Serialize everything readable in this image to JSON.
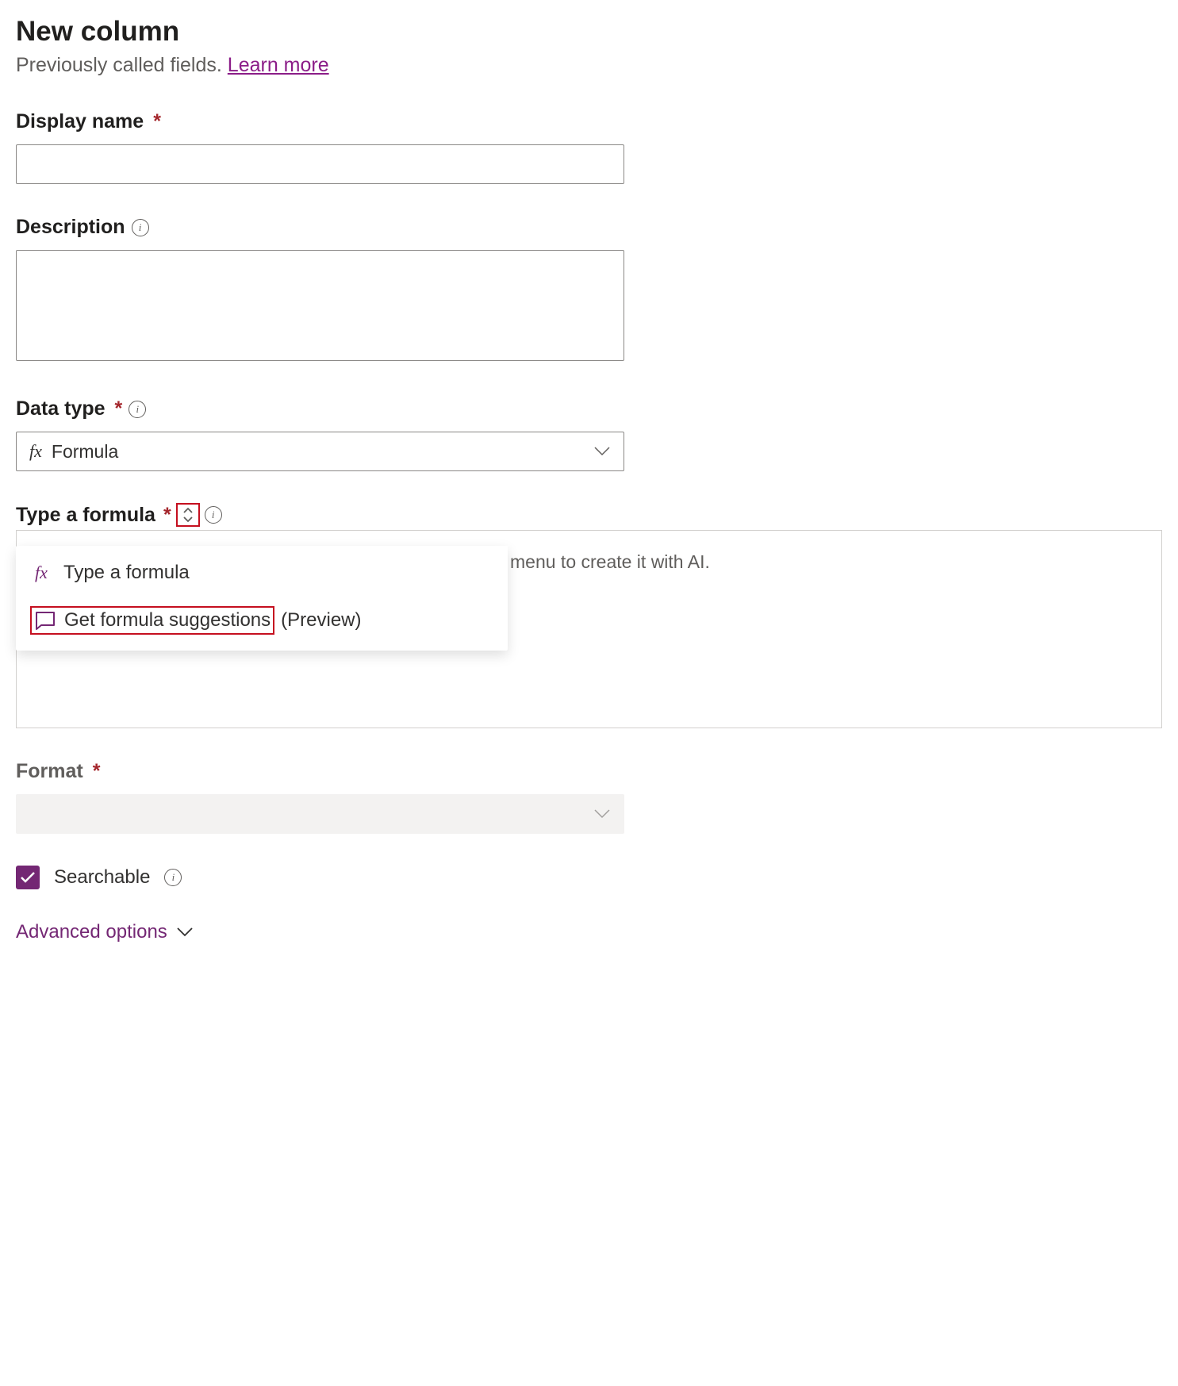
{
  "header": {
    "title": "New column",
    "subtitle_prefix": "Previously called fields. ",
    "learn_more_label": "Learn more"
  },
  "fields": {
    "display_name": {
      "label": "Display name",
      "value": ""
    },
    "description": {
      "label": "Description",
      "value": ""
    },
    "data_type": {
      "label": "Data type",
      "selected": "Formula"
    },
    "formula": {
      "label": "Type a formula",
      "placeholder": "menu to create it with AI.",
      "dropdown": {
        "item_manual": "Type a formula",
        "item_ai": "Get formula suggestions",
        "ai_suffix": "(Preview)"
      }
    },
    "format": {
      "label": "Format",
      "selected": ""
    },
    "searchable": {
      "label": "Searchable",
      "checked": true
    }
  },
  "advanced_options_label": "Advanced options"
}
